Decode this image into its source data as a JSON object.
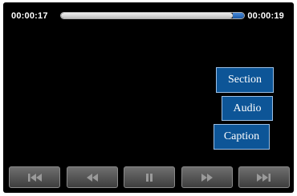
{
  "player": {
    "time_elapsed": "00:00:17",
    "time_total": "00:00:19",
    "progress": 0.94
  },
  "menu": {
    "section_label": "Section",
    "audio_label": "Audio",
    "caption_label": "Caption"
  },
  "controls": [
    {
      "icon": "skip-back-icon"
    },
    {
      "icon": "rewind-icon"
    },
    {
      "icon": "pause-icon"
    },
    {
      "icon": "fast-forward-icon"
    },
    {
      "icon": "skip-forward-icon"
    }
  ],
  "colors": {
    "menu_button": "#0d5597",
    "progress_accent": "#2f6fc0"
  }
}
